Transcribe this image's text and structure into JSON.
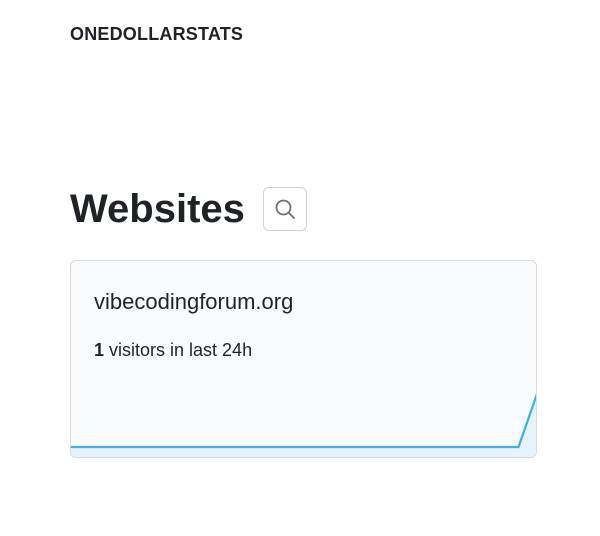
{
  "header": {
    "brand": "ONEDOLLARSTATS"
  },
  "main": {
    "title": "Websites",
    "search_icon": "search-icon",
    "sites": [
      {
        "domain": "vibecodingforum.org",
        "visitors_count": "1",
        "visitors_suffix": " visitors in last 24h",
        "sparkline": {
          "values": [
            0,
            0,
            0,
            0,
            0,
            0,
            0,
            0,
            0,
            0,
            0,
            0,
            0,
            0,
            0,
            0,
            0,
            0,
            0,
            0,
            0,
            0,
            0,
            0,
            1
          ],
          "line_color": "#3fb0e0",
          "fill_color": "#e6f3fa"
        }
      }
    ]
  }
}
